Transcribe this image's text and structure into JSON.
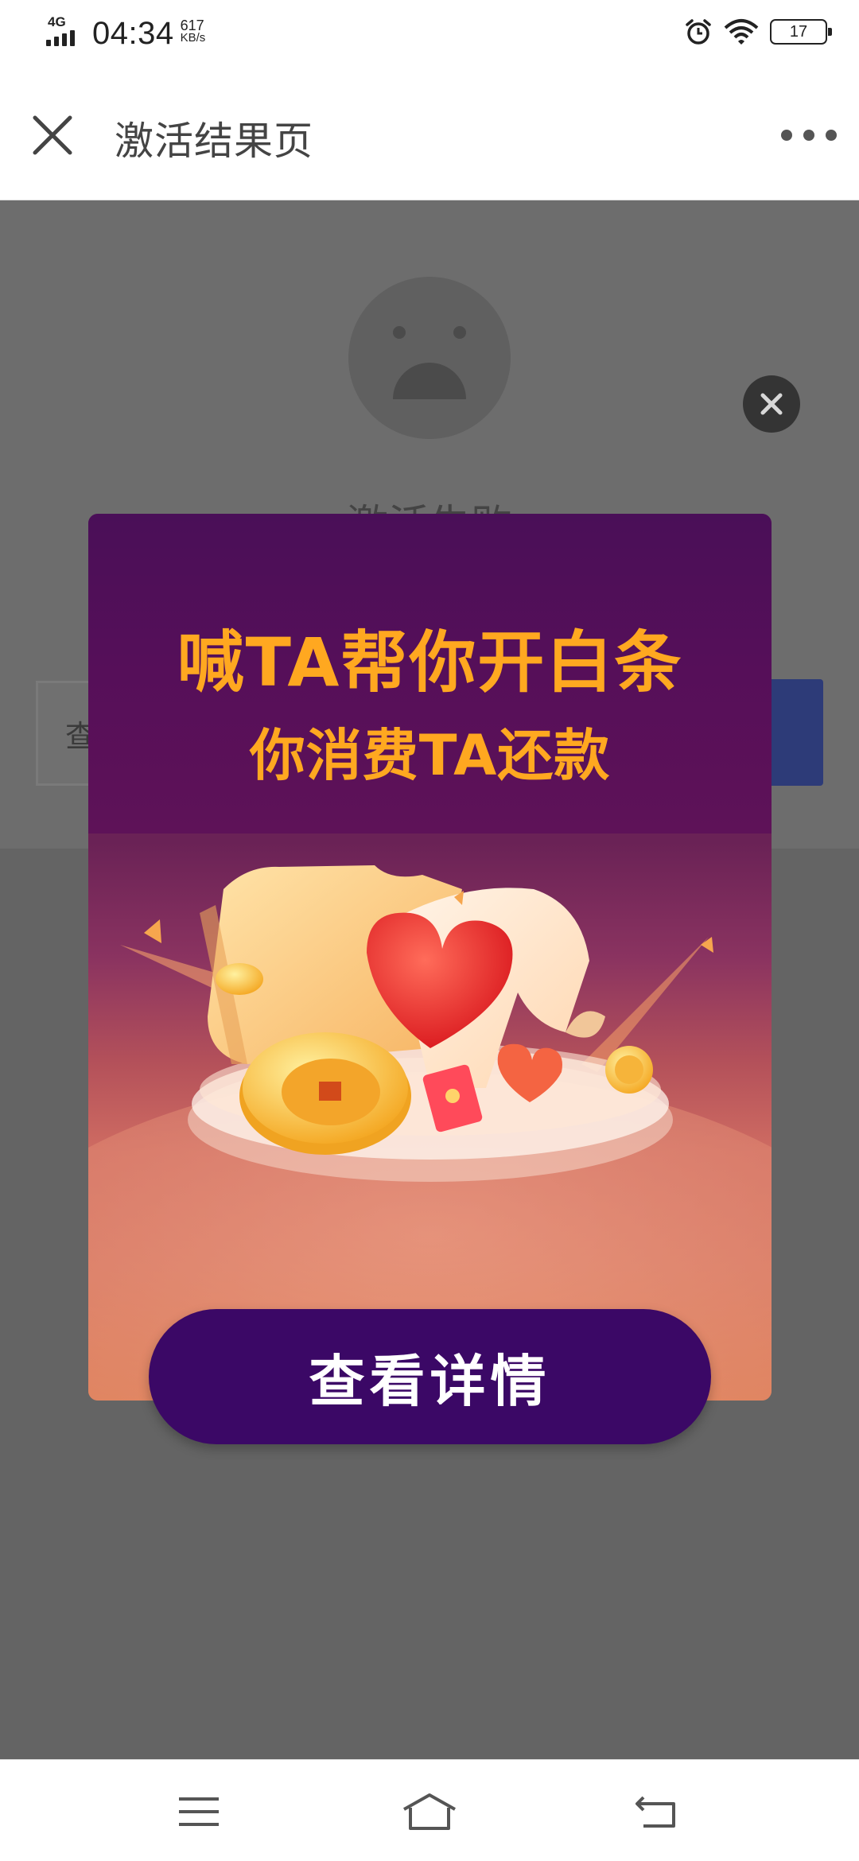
{
  "status_bar": {
    "network": "4G",
    "time": "04:34",
    "speed_value": "617",
    "speed_unit": "KB/s",
    "battery": "17"
  },
  "header": {
    "title": "激活结果页"
  },
  "page": {
    "fail_text": "激活失败",
    "query_button": "查"
  },
  "ad": {
    "headline": "喊TA帮你开白条",
    "subline": "你消费TA还款",
    "cta": "查看详情"
  },
  "colors": {
    "overlay": "#646464",
    "ad_purple": "#4a0f58",
    "ad_text": "#ffa820",
    "cta_bg": "#3b0866"
  }
}
